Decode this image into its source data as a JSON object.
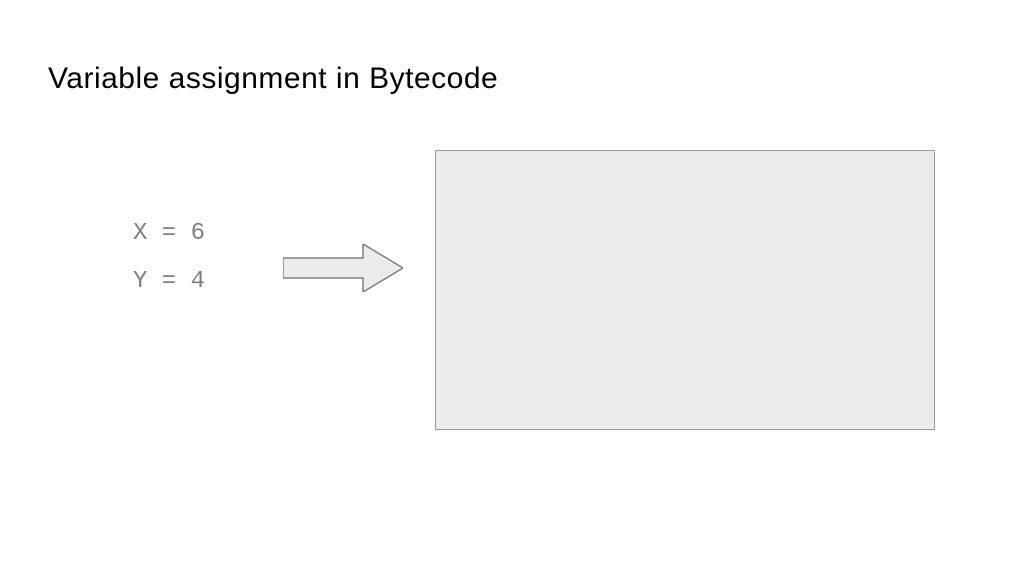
{
  "title": "Variable assignment in Bytecode",
  "code": {
    "line1": "X = 6",
    "line2": "Y = 4"
  },
  "colors": {
    "arrow_fill": "#ececec",
    "arrow_stroke": "#808080",
    "box_fill": "#ececec",
    "box_stroke": "#999999"
  }
}
